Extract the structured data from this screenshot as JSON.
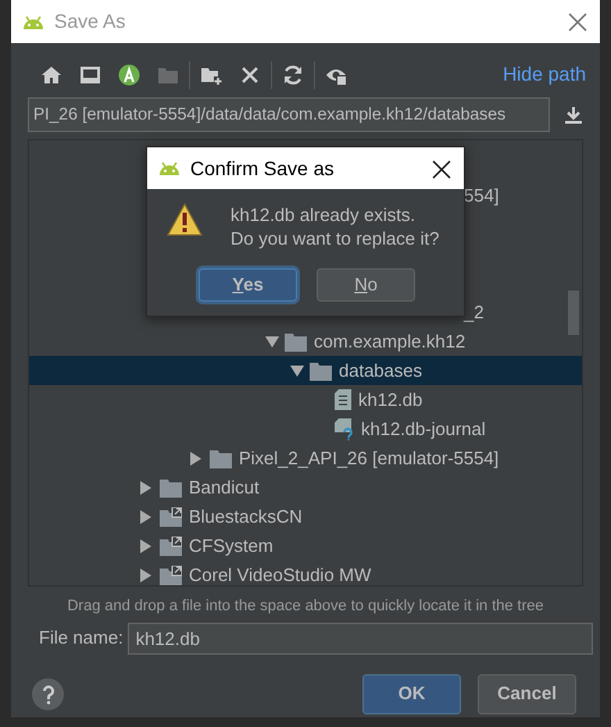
{
  "window": {
    "title": "Save As"
  },
  "toolbar": {
    "groups": [
      {
        "buttons": [
          {
            "kind": "home",
            "disabled": false
          },
          {
            "kind": "device",
            "disabled": false
          },
          {
            "kind": "android",
            "disabled": false
          },
          {
            "kind": "module",
            "disabled": true
          }
        ]
      },
      {
        "buttons": [
          {
            "kind": "new-folder",
            "disabled": false
          },
          {
            "kind": "delete",
            "disabled": false
          }
        ]
      },
      {
        "buttons": [
          {
            "kind": "refresh",
            "disabled": false
          }
        ]
      },
      {
        "buttons": [
          {
            "kind": "show-hidden",
            "disabled": false
          }
        ]
      }
    ],
    "hide_path": "Hide path"
  },
  "path": "PI_26 [emulator-5554]/data/data/com.example.kh12/databases",
  "tree": {
    "items": [
      {
        "kind": "offscreen",
        "children": [
          {
            "kind": "covered",
            "children": [
              {
                "kind": "covered"
              },
              {
                "kind": "fragment",
                "label": "554]",
                "children": [
                  {
                    "kind": "covered",
                    "children": [
                      {
                        "kind": "covered",
                        "children": [
                          {
                            "kind": "covered"
                          },
                          {
                            "kind": "fragment",
                            "label": "_2"
                          },
                          {
                            "kind": "folder",
                            "label": "com.example.kh12",
                            "expanded": true,
                            "selected": false,
                            "children": [
                              {
                                "kind": "folder",
                                "label": "databases",
                                "expanded": true,
                                "selected": true,
                                "children": [
                                  {
                                    "kind": "file",
                                    "label": "kh12.db",
                                    "selected": false
                                  },
                                  {
                                    "kind": "unknown-file",
                                    "label": "kh12.db-journal",
                                    "selected": false
                                  }
                                ]
                              }
                            ]
                          }
                        ]
                      }
                    ]
                  }
                ]
              },
              {
                "kind": "folder",
                "label": "Pixel_2_API_26 [emulator-5554]",
                "expanded": false,
                "selected": false
              }
            ]
          }
        ]
      },
      {
        "kind": "folder",
        "label": "Bandicut",
        "expanded": false,
        "selected": false
      },
      {
        "kind": "shortcut",
        "label": "BluestacksCN",
        "expanded": false,
        "selected": false
      },
      {
        "kind": "shortcut",
        "label": "CFSystem",
        "expanded": false,
        "selected": false
      },
      {
        "kind": "shortcut",
        "label": "Corel VideoStudio MW",
        "expanded": false,
        "selected": false
      }
    ]
  },
  "hint": "Drag and drop a file into the space above to quickly locate it in the tree",
  "file_name": {
    "label": "File name:",
    "value": "kh12.db"
  },
  "buttons": [
    {
      "label": "OK",
      "default": true
    },
    {
      "label": "Cancel",
      "default": false
    }
  ],
  "confirm": {
    "title": "Confirm Save as",
    "lines": [
      "kh12.db already exists.",
      "Do you want to replace it?"
    ],
    "buttons": [
      {
        "label": "Yes",
        "selected": true
      },
      {
        "label": "No",
        "selected": false
      }
    ]
  }
}
